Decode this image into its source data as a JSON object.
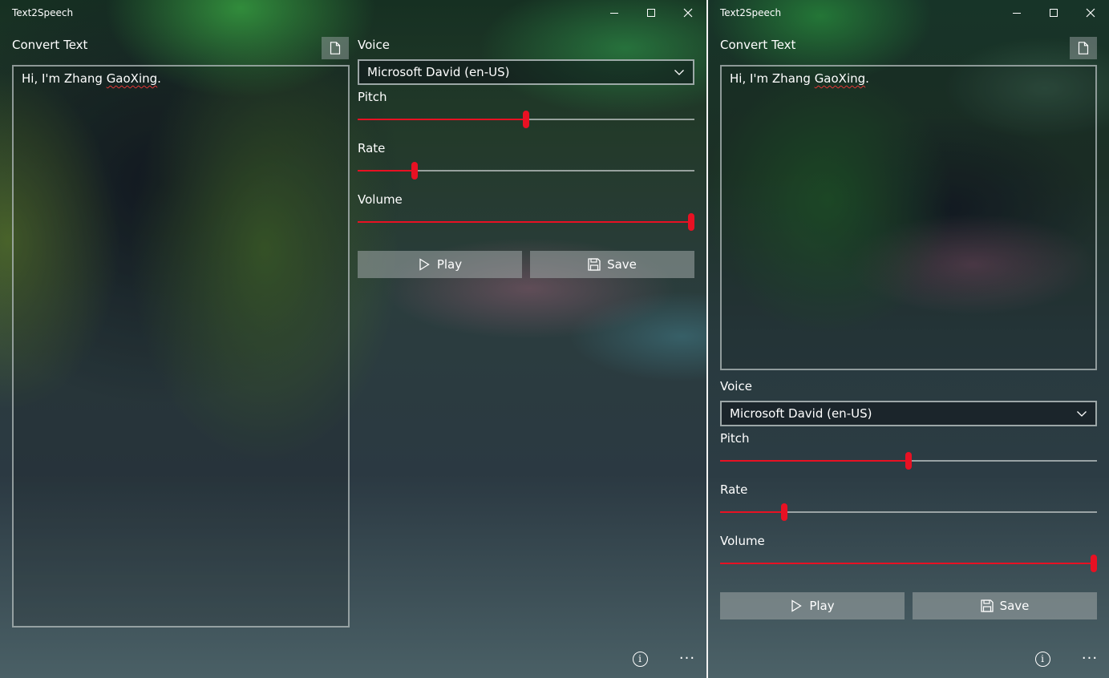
{
  "app": {
    "title": "Text2Speech"
  },
  "editor": {
    "label": "Convert Text",
    "text_prefix": "Hi, I'm Zhang ",
    "text_misspelled": "GaoXing",
    "text_suffix": "."
  },
  "voice": {
    "label": "Voice",
    "selected": "Microsoft David (en-US)"
  },
  "sliders": {
    "pitch": {
      "label": "Pitch",
      "value_fraction": 0.5
    },
    "rate": {
      "label": "Rate",
      "value_fraction": 0.17
    },
    "volume": {
      "label": "Volume",
      "value_fraction": 1.0
    }
  },
  "actions": {
    "play_label": "Play",
    "save_label": "Save"
  },
  "icons": {
    "open_file": "file-icon",
    "dropdown": "chevron-down-icon",
    "play": "play-icon",
    "save": "save-icon",
    "info": "info-icon",
    "more": "more-icon",
    "minimize": "minimize-icon",
    "maximize": "maximize-icon",
    "close": "close-icon"
  },
  "colors": {
    "accent": "#e81123"
  }
}
